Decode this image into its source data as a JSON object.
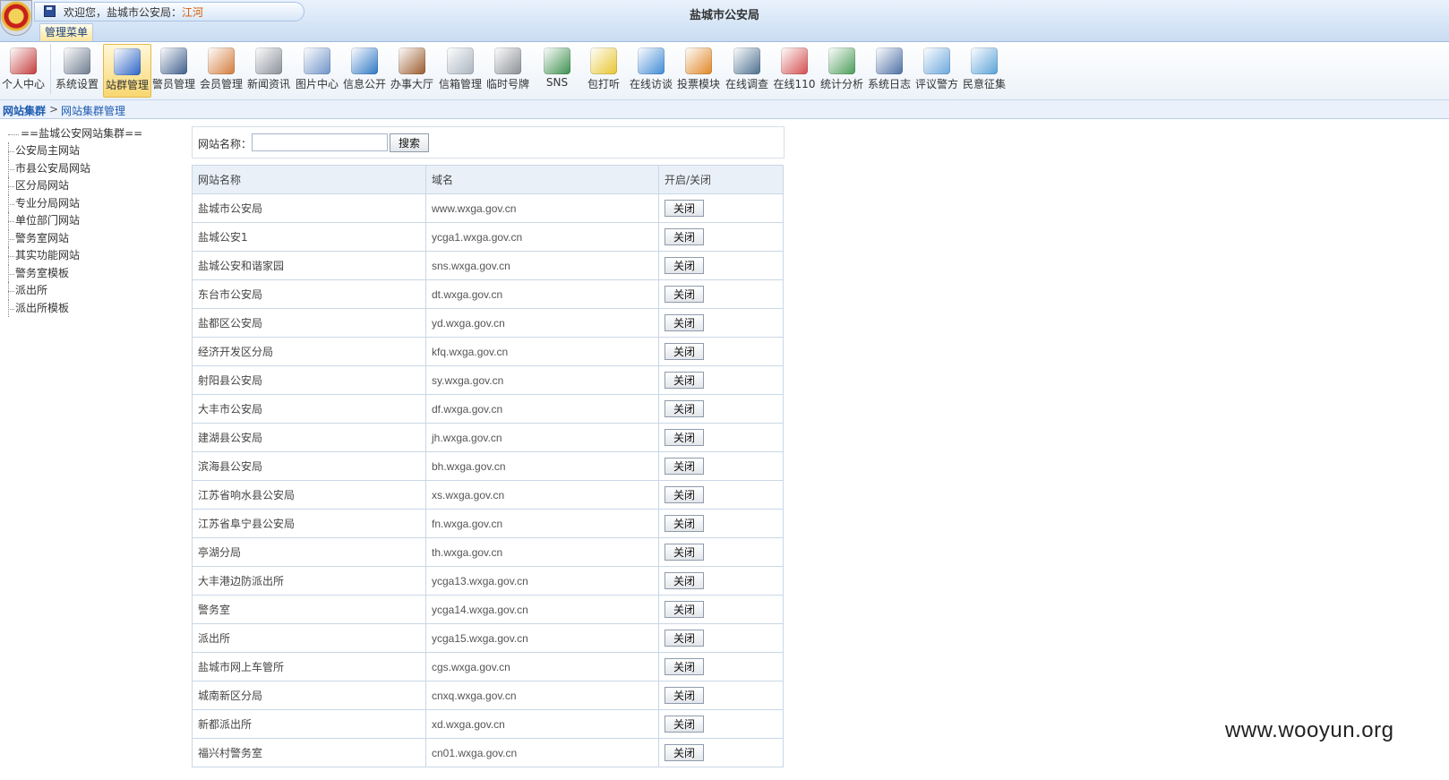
{
  "header": {
    "welcome": "欢迎您，盐城市公安局：",
    "username": "江河",
    "title": "盐城市公安局",
    "menu_tab": "管理菜单"
  },
  "toolbar": [
    {
      "label": "个人中心",
      "icon": "id-card-icon",
      "color": "#c43b3b",
      "active": false
    },
    {
      "label": "系统设置",
      "icon": "gear-server-icon",
      "color": "#6d7b8e",
      "active": false
    },
    {
      "label": "站群管理",
      "icon": "network-icon",
      "color": "#2b63c6",
      "active": true
    },
    {
      "label": "警员管理",
      "icon": "police-icon",
      "color": "#3d5d8c",
      "active": false
    },
    {
      "label": "会员管理",
      "icon": "users-icon",
      "color": "#d47b3a",
      "active": false
    },
    {
      "label": "新闻资讯",
      "icon": "newspaper-icon",
      "color": "#8a8f98",
      "active": false
    },
    {
      "label": "图片中心",
      "icon": "picture-icon",
      "color": "#6f93c8",
      "active": false
    },
    {
      "label": "信息公开",
      "icon": "info-globe-icon",
      "color": "#2d77c5",
      "active": false
    },
    {
      "label": "办事大厅",
      "icon": "briefcase-icon",
      "color": "#9a5a2b",
      "active": false
    },
    {
      "label": "信箱管理",
      "icon": "mail-icon",
      "color": "#a9b3bf",
      "active": false
    },
    {
      "label": "临时号牌",
      "icon": "car-icon",
      "color": "#8a8e94",
      "active": false
    },
    {
      "label": "SNS",
      "icon": "sns-icon",
      "color": "#3c8f4d",
      "active": false
    },
    {
      "label": "包打听",
      "icon": "lightbulb-icon",
      "color": "#e7c52d",
      "active": false
    },
    {
      "label": "在线访谈",
      "icon": "chat-icon",
      "color": "#3e8ad6",
      "active": false
    },
    {
      "label": "投票模块",
      "icon": "bar-chart-icon",
      "color": "#e08624",
      "active": false
    },
    {
      "label": "在线调查",
      "icon": "survey-icon",
      "color": "#4b6f8f",
      "active": false
    },
    {
      "label": "在线110",
      "icon": "operator-icon",
      "color": "#d44d4d",
      "active": false
    },
    {
      "label": "统计分析",
      "icon": "line-chart-icon",
      "color": "#4a9c58",
      "active": false
    },
    {
      "label": "系统日志",
      "icon": "log-icon",
      "color": "#4c6fa5",
      "active": false
    },
    {
      "label": "评议警方",
      "icon": "review-icon",
      "color": "#6ba7dd",
      "active": false
    },
    {
      "label": "民意征集",
      "icon": "people-icon",
      "color": "#59a2d8",
      "active": false
    }
  ],
  "breadcrumb": {
    "root": "网站集群",
    "arrow": ">",
    "current": "网站集群管理"
  },
  "tree": {
    "root": "==盐城公安网站集群==",
    "items": [
      "公安局主网站",
      "市县公安局网站",
      "区分局网站",
      "专业分局网站",
      "单位部门网站",
      "警务室网站",
      "其实功能网站",
      "警务室模板",
      "派出所",
      "派出所模板"
    ]
  },
  "search": {
    "label": "网站名称：",
    "value": "",
    "button": "搜索"
  },
  "table": {
    "headers": [
      "网站名称",
      "域名",
      "开启/关闭"
    ],
    "rows": [
      {
        "name": "盐城市公安局",
        "domain": "www.wxga.gov.cn",
        "action": "关闭"
      },
      {
        "name": "盐城公安1",
        "domain": "ycga1.wxga.gov.cn",
        "action": "关闭"
      },
      {
        "name": "盐城公安和谐家园",
        "domain": "sns.wxga.gov.cn",
        "action": "关闭"
      },
      {
        "name": "东台市公安局",
        "domain": "dt.wxga.gov.cn",
        "action": "关闭"
      },
      {
        "name": "盐都区公安局",
        "domain": "yd.wxga.gov.cn",
        "action": "关闭"
      },
      {
        "name": "经济开发区分局",
        "domain": "kfq.wxga.gov.cn",
        "action": "关闭"
      },
      {
        "name": "射阳县公安局",
        "domain": "sy.wxga.gov.cn",
        "action": "关闭"
      },
      {
        "name": "大丰市公安局",
        "domain": "df.wxga.gov.cn",
        "action": "关闭"
      },
      {
        "name": "建湖县公安局",
        "domain": "jh.wxga.gov.cn",
        "action": "关闭"
      },
      {
        "name": "滨海县公安局",
        "domain": "bh.wxga.gov.cn",
        "action": "关闭"
      },
      {
        "name": "江苏省响水县公安局",
        "domain": "xs.wxga.gov.cn",
        "action": "关闭"
      },
      {
        "name": "江苏省阜宁县公安局",
        "domain": "fn.wxga.gov.cn",
        "action": "关闭"
      },
      {
        "name": "亭湖分局",
        "domain": "th.wxga.gov.cn",
        "action": "关闭"
      },
      {
        "name": "大丰港边防派出所",
        "domain": "ycga13.wxga.gov.cn",
        "action": "关闭"
      },
      {
        "name": "警务室",
        "domain": "ycga14.wxga.gov.cn",
        "action": "关闭"
      },
      {
        "name": "派出所",
        "domain": "ycga15.wxga.gov.cn",
        "action": "关闭"
      },
      {
        "name": "盐城市网上车管所",
        "domain": "cgs.wxga.gov.cn",
        "action": "关闭"
      },
      {
        "name": "城南新区分局",
        "domain": "cnxq.wxga.gov.cn",
        "action": "关闭"
      },
      {
        "name": "新都派出所",
        "domain": "xd.wxga.gov.cn",
        "action": "关闭"
      },
      {
        "name": "福兴村警务室",
        "domain": "cn01.wxga.gov.cn",
        "action": "关闭"
      }
    ]
  },
  "watermark": "www.wooyun.org"
}
